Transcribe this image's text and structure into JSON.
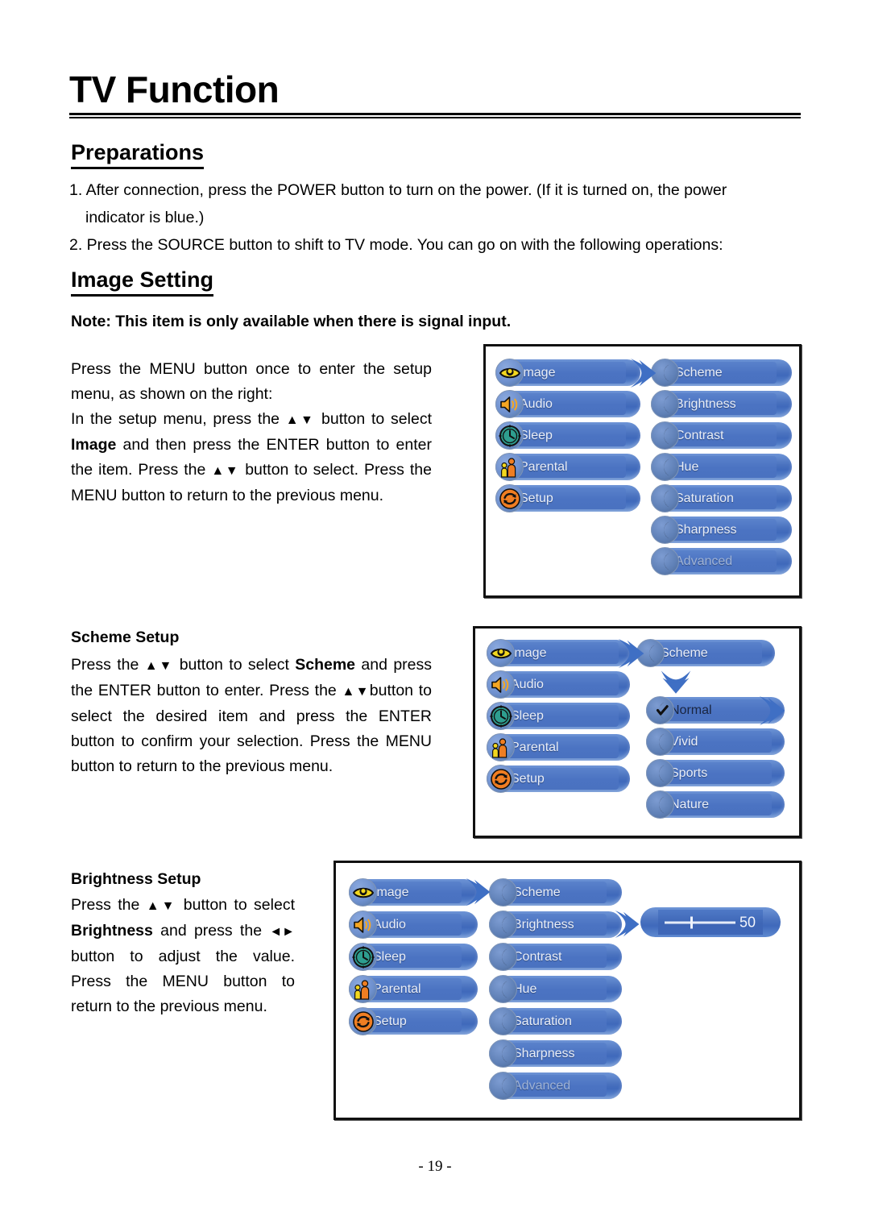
{
  "page": {
    "title": "TV Function",
    "footer": "- 19 -"
  },
  "preparations": {
    "heading": "Preparations",
    "item1": "1. After connection, press the POWER button to turn on the power. (If it is turned on, the power",
    "item1_cont": "indicator is blue.)",
    "item2": "2. Press the SOURCE button to shift to TV mode. You can go on with the following operations:"
  },
  "image_setting": {
    "heading": "Image Setting",
    "note": "Note: This item is only available when there is signal input.",
    "body_1": "Press the MENU button once to enter the setup menu, as shown on the right:",
    "body_2_a": "In the setup menu, press the ",
    "body_2_arrows": "▲▼",
    "body_2_b": " button to select ",
    "body_2_strong": "Image",
    "body_2_c": " and then press the ENTER button to enter the item. Press the ",
    "body_2_arrows2": "▲▼",
    "body_2_d": " button to select. Press the MENU button to return to the previous menu."
  },
  "scheme_setup": {
    "heading": "Scheme Setup",
    "body_a": "Press the ",
    "arrows1": "▲▼",
    "body_b": " button to select ",
    "strong": "Scheme",
    "body_c": " and press the ENTER button to enter. Press the ",
    "arrows2": "▲▼",
    "body_d": "button to select the desired item and press the ENTER button to confirm your selection. Press the MENU button to return to the previous menu."
  },
  "brightness_setup": {
    "heading": "Brightness Setup",
    "body_a": "Press the ",
    "arrows1": "▲▼",
    "body_b": " button to select ",
    "strong": "Brightness",
    "body_c": " and press the ",
    "arrows2": "◄►",
    "body_d": " button to adjust the value. Press the MENU button to return to the previous menu."
  },
  "osd": {
    "main_menu": [
      {
        "label": "Image",
        "icon": "eye-icon"
      },
      {
        "label": "Audio",
        "icon": "speaker-icon"
      },
      {
        "label": "Sleep",
        "icon": "clock-icon"
      },
      {
        "label": "Parental",
        "icon": "parental-icon"
      },
      {
        "label": "Setup",
        "icon": "refresh-icon"
      }
    ],
    "image_submenu": [
      {
        "label": "Scheme",
        "state": "normal"
      },
      {
        "label": "Brightness",
        "state": "normal"
      },
      {
        "label": "Contrast",
        "state": "normal"
      },
      {
        "label": "Hue",
        "state": "normal"
      },
      {
        "label": "Saturation",
        "state": "normal"
      },
      {
        "label": "Sharpness",
        "state": "normal"
      },
      {
        "label": "Advanced",
        "state": "disabled"
      }
    ],
    "scheme_parent": {
      "label": "Scheme"
    },
    "scheme_options": [
      {
        "label": "Normal",
        "state": "selected"
      },
      {
        "label": "Vivid",
        "state": "normal"
      },
      {
        "label": "Sports",
        "state": "normal"
      },
      {
        "label": "Nature",
        "state": "normal"
      }
    ],
    "brightness_slider": {
      "value": "50"
    },
    "colors": {
      "pill_blue": "#4a72bf",
      "pill_light": "#6d94d6",
      "icon_eye": "#f2d71f",
      "icon_speaker": "#f5a623",
      "icon_clock": "#2e9e8f",
      "icon_parental": "#ef7e22",
      "icon_setup": "#f07e22"
    }
  }
}
